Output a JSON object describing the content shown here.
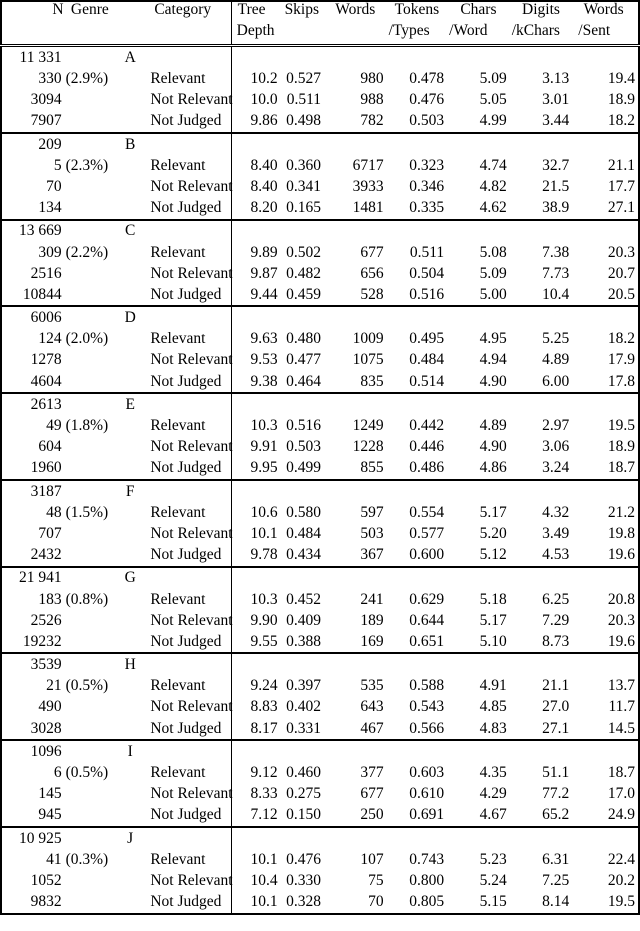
{
  "table": {
    "caption_columns_left": [
      "N",
      "Genre",
      "Category"
    ],
    "header_row1": [
      "N",
      "Genre",
      "Category",
      "Tree",
      "Skips",
      "Words",
      "Tokens",
      "Chars",
      "Digits",
      "Words"
    ],
    "header_row2": [
      "",
      "",
      "",
      "Depth",
      "",
      "",
      "/Types",
      "/Word",
      "/kChars",
      "/Sent"
    ],
    "header": {
      "n": "N",
      "genre": "Genre",
      "category": "Category",
      "tree": "Tree",
      "depth": "Depth",
      "skips": "Skips",
      "words": "Words",
      "tokens": "Tokens",
      "tokens_sub": "/Types",
      "chars": "Chars",
      "chars_sub": "/Word",
      "digits": "Digits",
      "digits_sub": "/kChars",
      "words2": "Words",
      "words2_sub": "/Sent"
    },
    "category_labels": {
      "relevant": "Relevant",
      "not_relevant": "Not Relevant",
      "not_judged": "Not Judged"
    },
    "groups": [
      {
        "total_n": "11 331",
        "genre": "A",
        "rows": [
          {
            "n": "330",
            "pct": "(2.9%)",
            "category": "Relevant",
            "tree_depth": "10.2",
            "skips": "0.527",
            "words": "980",
            "tokens_types": "0.478",
            "chars_word": "5.09",
            "digits_kchars": "3.13",
            "words_sent": "19.4"
          },
          {
            "n": "3094",
            "pct": "",
            "category": "Not Relevant",
            "tree_depth": "10.0",
            "skips": "0.511",
            "words": "988",
            "tokens_types": "0.476",
            "chars_word": "5.05",
            "digits_kchars": "3.01",
            "words_sent": "18.9"
          },
          {
            "n": "7907",
            "pct": "",
            "category": "Not Judged",
            "tree_depth": "9.86",
            "skips": "0.498",
            "words": "782",
            "tokens_types": "0.503",
            "chars_word": "4.99",
            "digits_kchars": "3.44",
            "words_sent": "18.2"
          }
        ]
      },
      {
        "total_n": "209",
        "genre": "B",
        "rows": [
          {
            "n": "5",
            "pct": "(2.3%)",
            "category": "Relevant",
            "tree_depth": "8.40",
            "skips": "0.360",
            "words": "6717",
            "tokens_types": "0.323",
            "chars_word": "4.74",
            "digits_kchars": "32.7",
            "words_sent": "21.1"
          },
          {
            "n": "70",
            "pct": "",
            "category": "Not Relevant",
            "tree_depth": "8.40",
            "skips": "0.341",
            "words": "3933",
            "tokens_types": "0.346",
            "chars_word": "4.82",
            "digits_kchars": "21.5",
            "words_sent": "17.7"
          },
          {
            "n": "134",
            "pct": "",
            "category": "Not Judged",
            "tree_depth": "8.20",
            "skips": "0.165",
            "words": "1481",
            "tokens_types": "0.335",
            "chars_word": "4.62",
            "digits_kchars": "38.9",
            "words_sent": "27.1"
          }
        ]
      },
      {
        "total_n": "13 669",
        "genre": "C",
        "rows": [
          {
            "n": "309",
            "pct": "(2.2%)",
            "category": "Relevant",
            "tree_depth": "9.89",
            "skips": "0.502",
            "words": "677",
            "tokens_types": "0.511",
            "chars_word": "5.08",
            "digits_kchars": "7.38",
            "words_sent": "20.3"
          },
          {
            "n": "2516",
            "pct": "",
            "category": "Not Relevant",
            "tree_depth": "9.87",
            "skips": "0.482",
            "words": "656",
            "tokens_types": "0.504",
            "chars_word": "5.09",
            "digits_kchars": "7.73",
            "words_sent": "20.7"
          },
          {
            "n": "10844",
            "pct": "",
            "category": "Not Judged",
            "tree_depth": "9.44",
            "skips": "0.459",
            "words": "528",
            "tokens_types": "0.516",
            "chars_word": "5.00",
            "digits_kchars": "10.4",
            "words_sent": "20.5"
          }
        ]
      },
      {
        "total_n": "6006",
        "genre": "D",
        "rows": [
          {
            "n": "124",
            "pct": "(2.0%)",
            "category": "Relevant",
            "tree_depth": "9.63",
            "skips": "0.480",
            "words": "1009",
            "tokens_types": "0.495",
            "chars_word": "4.95",
            "digits_kchars": "5.25",
            "words_sent": "18.2"
          },
          {
            "n": "1278",
            "pct": "",
            "category": "Not Relevant",
            "tree_depth": "9.53",
            "skips": "0.477",
            "words": "1075",
            "tokens_types": "0.484",
            "chars_word": "4.94",
            "digits_kchars": "4.89",
            "words_sent": "17.9"
          },
          {
            "n": "4604",
            "pct": "",
            "category": "Not Judged",
            "tree_depth": "9.38",
            "skips": "0.464",
            "words": "835",
            "tokens_types": "0.514",
            "chars_word": "4.90",
            "digits_kchars": "6.00",
            "words_sent": "17.8"
          }
        ]
      },
      {
        "total_n": "2613",
        "genre": "E",
        "rows": [
          {
            "n": "49",
            "pct": "(1.8%)",
            "category": "Relevant",
            "tree_depth": "10.3",
            "skips": "0.516",
            "words": "1249",
            "tokens_types": "0.442",
            "chars_word": "4.89",
            "digits_kchars": "2.97",
            "words_sent": "19.5"
          },
          {
            "n": "604",
            "pct": "",
            "category": "Not Relevant",
            "tree_depth": "9.91",
            "skips": "0.503",
            "words": "1228",
            "tokens_types": "0.446",
            "chars_word": "4.90",
            "digits_kchars": "3.06",
            "words_sent": "18.9"
          },
          {
            "n": "1960",
            "pct": "",
            "category": "Not Judged",
            "tree_depth": "9.95",
            "skips": "0.499",
            "words": "855",
            "tokens_types": "0.486",
            "chars_word": "4.86",
            "digits_kchars": "3.24",
            "words_sent": "18.7"
          }
        ]
      },
      {
        "total_n": "3187",
        "genre": "F",
        "rows": [
          {
            "n": "48",
            "pct": "(1.5%)",
            "category": "Relevant",
            "tree_depth": "10.6",
            "skips": "0.580",
            "words": "597",
            "tokens_types": "0.554",
            "chars_word": "5.17",
            "digits_kchars": "4.32",
            "words_sent": "21.2"
          },
          {
            "n": "707",
            "pct": "",
            "category": "Not Relevant",
            "tree_depth": "10.1",
            "skips": "0.484",
            "words": "503",
            "tokens_types": "0.577",
            "chars_word": "5.20",
            "digits_kchars": "3.49",
            "words_sent": "19.8"
          },
          {
            "n": "2432",
            "pct": "",
            "category": "Not Judged",
            "tree_depth": "9.78",
            "skips": "0.434",
            "words": "367",
            "tokens_types": "0.600",
            "chars_word": "5.12",
            "digits_kchars": "4.53",
            "words_sent": "19.6"
          }
        ]
      },
      {
        "total_n": "21 941",
        "genre": "G",
        "rows": [
          {
            "n": "183",
            "pct": "(0.8%)",
            "category": "Relevant",
            "tree_depth": "10.3",
            "skips": "0.452",
            "words": "241",
            "tokens_types": "0.629",
            "chars_word": "5.18",
            "digits_kchars": "6.25",
            "words_sent": "20.8"
          },
          {
            "n": "2526",
            "pct": "",
            "category": "Not Relevant",
            "tree_depth": "9.90",
            "skips": "0.409",
            "words": "189",
            "tokens_types": "0.644",
            "chars_word": "5.17",
            "digits_kchars": "7.29",
            "words_sent": "20.3"
          },
          {
            "n": "19232",
            "pct": "",
            "category": "Not Judged",
            "tree_depth": "9.55",
            "skips": "0.388",
            "words": "169",
            "tokens_types": "0.651",
            "chars_word": "5.10",
            "digits_kchars": "8.73",
            "words_sent": "19.6"
          }
        ]
      },
      {
        "total_n": "3539",
        "genre": "H",
        "rows": [
          {
            "n": "21",
            "pct": "(0.5%)",
            "category": "Relevant",
            "tree_depth": "9.24",
            "skips": "0.397",
            "words": "535",
            "tokens_types": "0.588",
            "chars_word": "4.91",
            "digits_kchars": "21.1",
            "words_sent": "13.7"
          },
          {
            "n": "490",
            "pct": "",
            "category": "Not Relevant",
            "tree_depth": "8.83",
            "skips": "0.402",
            "words": "643",
            "tokens_types": "0.543",
            "chars_word": "4.85",
            "digits_kchars": "27.0",
            "words_sent": "11.7"
          },
          {
            "n": "3028",
            "pct": "",
            "category": "Not Judged",
            "tree_depth": "8.17",
            "skips": "0.331",
            "words": "467",
            "tokens_types": "0.566",
            "chars_word": "4.83",
            "digits_kchars": "27.1",
            "words_sent": "14.5"
          }
        ]
      },
      {
        "total_n": "1096",
        "genre": "I",
        "rows": [
          {
            "n": "6",
            "pct": "(0.5%)",
            "category": "Relevant",
            "tree_depth": "9.12",
            "skips": "0.460",
            "words": "377",
            "tokens_types": "0.603",
            "chars_word": "4.35",
            "digits_kchars": "51.1",
            "words_sent": "18.7"
          },
          {
            "n": "145",
            "pct": "",
            "category": "Not Relevant",
            "tree_depth": "8.33",
            "skips": "0.275",
            "words": "677",
            "tokens_types": "0.610",
            "chars_word": "4.29",
            "digits_kchars": "77.2",
            "words_sent": "17.0"
          },
          {
            "n": "945",
            "pct": "",
            "category": "Not Judged",
            "tree_depth": "7.12",
            "skips": "0.150",
            "words": "250",
            "tokens_types": "0.691",
            "chars_word": "4.67",
            "digits_kchars": "65.2",
            "words_sent": "24.9"
          }
        ]
      },
      {
        "total_n": "10 925",
        "genre": "J",
        "rows": [
          {
            "n": "41",
            "pct": "(0.3%)",
            "category": "Relevant",
            "tree_depth": "10.1",
            "skips": "0.476",
            "words": "107",
            "tokens_types": "0.743",
            "chars_word": "5.23",
            "digits_kchars": "6.31",
            "words_sent": "22.4"
          },
          {
            "n": "1052",
            "pct": "",
            "category": "Not Relevant",
            "tree_depth": "10.4",
            "skips": "0.330",
            "words": "75",
            "tokens_types": "0.800",
            "chars_word": "5.24",
            "digits_kchars": "7.25",
            "words_sent": "20.2"
          },
          {
            "n": "9832",
            "pct": "",
            "category": "Not Judged",
            "tree_depth": "10.1",
            "skips": "0.328",
            "words": "70",
            "tokens_types": "0.805",
            "chars_word": "5.15",
            "digits_kchars": "8.14",
            "words_sent": "19.5"
          }
        ]
      }
    ]
  }
}
